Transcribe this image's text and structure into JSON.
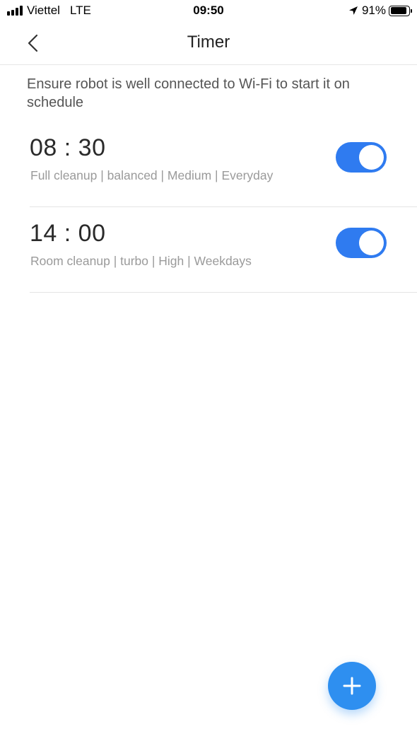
{
  "status_bar": {
    "carrier": "Viettel",
    "network": "LTE",
    "time": "09:50",
    "battery_percent": "91%",
    "icons": [
      "signal-icon",
      "location-arrow-icon",
      "battery-icon"
    ]
  },
  "nav": {
    "title": "Timer",
    "back_icon": "chevron-left-icon"
  },
  "notice": "Ensure robot is well connected to Wi-Fi to start it on schedule",
  "timers": [
    {
      "time": "08 : 30",
      "description": "Full cleanup | balanced | Medium | Everyday",
      "enabled": true
    },
    {
      "time": "14 : 00",
      "description": "Room cleanup | turbo | High | Weekdays",
      "enabled": true
    }
  ],
  "fab": {
    "icon": "plus-icon"
  },
  "colors": {
    "toggle_on": "#2f7bf0",
    "fab": "#2e8ff0",
    "divider": "#e4e4e4",
    "secondary_text": "#9a9a9a"
  }
}
